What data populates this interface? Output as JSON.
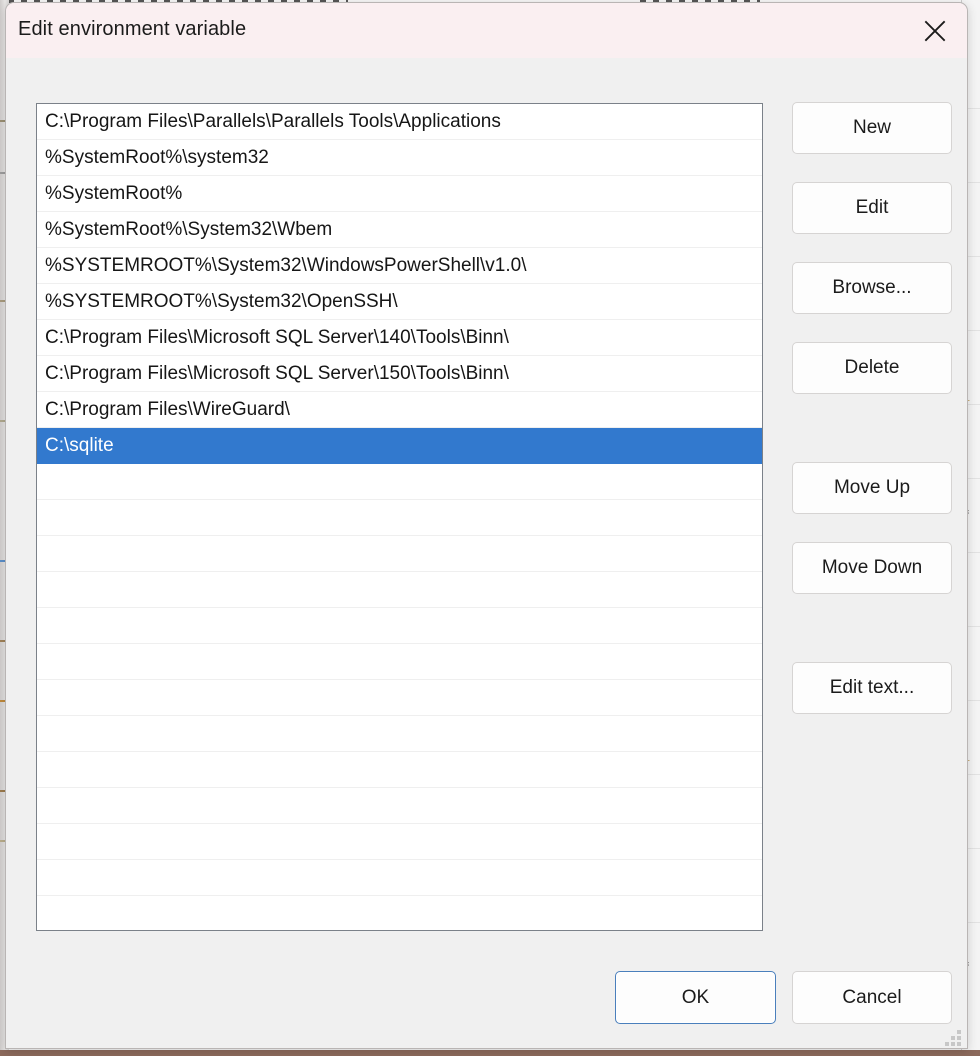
{
  "window": {
    "title": "Edit environment variable",
    "close_icon": "close-icon"
  },
  "colors": {
    "titlebar_bg": "#faeff1",
    "dialog_bg": "#f0f0f0",
    "selection_blue": "#3279ce",
    "default_button_border": "#4a7fbc",
    "list_border": "#7b8189"
  },
  "list": {
    "name": "path-entries-list",
    "selected_index": 9,
    "visible_row_count": 23,
    "entries": [
      "C:\\Program Files\\Parallels\\Parallels Tools\\Applications",
      "%SystemRoot%\\system32",
      "%SystemRoot%",
      "%SystemRoot%\\System32\\Wbem",
      "%SYSTEMROOT%\\System32\\WindowsPowerShell\\v1.0\\",
      "%SYSTEMROOT%\\System32\\OpenSSH\\",
      "C:\\Program Files\\Microsoft SQL Server\\140\\Tools\\Binn\\",
      "C:\\Program Files\\Microsoft SQL Server\\150\\Tools\\Binn\\",
      "C:\\Program Files\\WireGuard\\",
      "C:\\sqlite",
      "",
      "",
      "",
      "",
      "",
      "",
      "",
      "",
      "",
      "",
      "",
      "",
      ""
    ]
  },
  "side_buttons": [
    {
      "id": "new",
      "label": "New"
    },
    {
      "id": "edit",
      "label": "Edit"
    },
    {
      "id": "browse",
      "label": "Browse..."
    },
    {
      "id": "delete",
      "label": "Delete"
    },
    {
      "id": "move-up",
      "label": "Move Up"
    },
    {
      "id": "move-down",
      "label": "Move Down"
    },
    {
      "id": "edit-text",
      "label": "Edit text..."
    }
  ],
  "footer": {
    "ok_label": "OK",
    "cancel_label": "Cancel",
    "default_button": "OK"
  },
  "grip": {
    "name": "resize-grip"
  }
}
